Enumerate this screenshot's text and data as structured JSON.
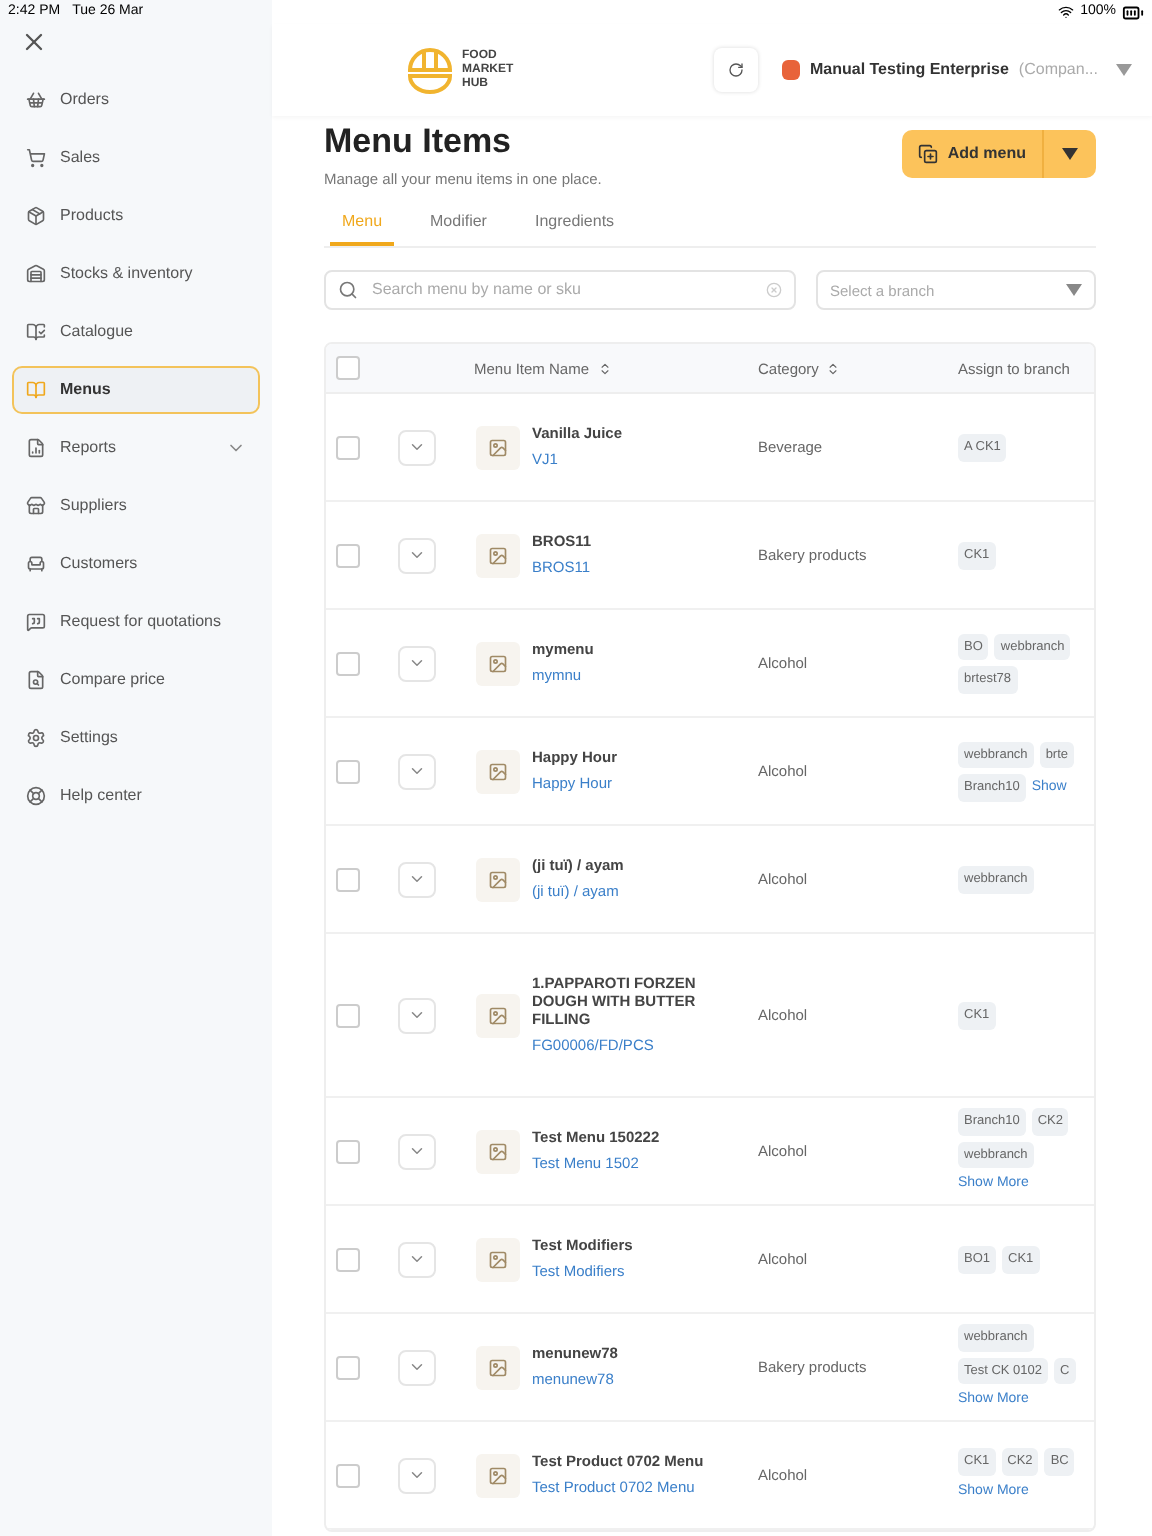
{
  "status_bar": {
    "time": "2:42 PM",
    "date": "Tue 26 Mar",
    "battery": "100%"
  },
  "sidebar": {
    "items": [
      {
        "label": "Orders",
        "selected": false
      },
      {
        "label": "Sales",
        "selected": false
      },
      {
        "label": "Products",
        "selected": false
      },
      {
        "label": "Stocks & inventory",
        "selected": false
      },
      {
        "label": "Catalogue",
        "selected": false
      },
      {
        "label": "Menus",
        "selected": true
      },
      {
        "label": "Reports",
        "selected": false,
        "expandable": true
      },
      {
        "label": "Suppliers",
        "selected": false
      },
      {
        "label": "Customers",
        "selected": false
      },
      {
        "label": "Request for quotations",
        "selected": false
      },
      {
        "label": "Compare price",
        "selected": false
      },
      {
        "label": "Settings",
        "selected": false
      },
      {
        "label": "Help center",
        "selected": false
      }
    ]
  },
  "header": {
    "logo_text": "FOOD MARKET HUB",
    "company": "Manual Testing Enterprise",
    "company_note": "(Compan..."
  },
  "page": {
    "title": "Menu Items",
    "subtitle": "Manage all your menu items in one place.",
    "add_button": "Add menu"
  },
  "tabs": [
    {
      "label": "Menu",
      "selected": true
    },
    {
      "label": "Modifier",
      "selected": false
    },
    {
      "label": "Ingredients",
      "selected": false
    }
  ],
  "search": {
    "placeholder": "Search menu by name or sku"
  },
  "branch_select": {
    "placeholder": "Select a branch"
  },
  "table": {
    "select_all_checked": false,
    "columns": [
      "Menu Item Name",
      "Category",
      "Assign to branch"
    ],
    "rows": [
      {
        "checked": false,
        "name": "Vanilla Juice",
        "sku": "VJ1",
        "category": "Beverage",
        "branch_lines": [
          [
            {
              "kind": "tag",
              "text": "A CK1"
            }
          ]
        ]
      },
      {
        "checked": false,
        "name": "BROS11",
        "sku": "BROS11",
        "category": "Bakery products",
        "branch_lines": [
          [
            {
              "kind": "tag",
              "text": "CK1"
            }
          ]
        ]
      },
      {
        "checked": false,
        "name": "mymenu",
        "sku": "mymnu",
        "category": "Alcohol",
        "branch_lines": [
          [
            {
              "kind": "tag",
              "text": "BO"
            },
            {
              "kind": "tag",
              "text": "webbranch"
            }
          ],
          [
            {
              "kind": "tag",
              "text": "brtest78"
            }
          ]
        ]
      },
      {
        "checked": false,
        "name": "Happy Hour",
        "sku": "Happy Hour",
        "category": "Alcohol",
        "branch_lines": [
          [
            {
              "kind": "tag",
              "text": "webbranch"
            },
            {
              "kind": "tag",
              "text": "brte"
            }
          ],
          [
            {
              "kind": "tag",
              "text": "Branch10"
            },
            {
              "kind": "link",
              "text": "Show"
            }
          ]
        ]
      },
      {
        "checked": false,
        "name": "(ji tuï) / ayam",
        "sku": "(ji tuï) / ayam",
        "category": "Alcohol",
        "branch_lines": [
          [
            {
              "kind": "tag",
              "text": "webbranch"
            }
          ]
        ]
      },
      {
        "checked": false,
        "name": "1.PAPPAROTI FORZEN DOUGH WITH BUTTER FILLING",
        "sku": "FG00006/FD/PCS",
        "category": "Alcohol",
        "branch_lines": [
          [
            {
              "kind": "tag",
              "text": "CK1"
            }
          ]
        ],
        "tall": true
      },
      {
        "checked": false,
        "name": "Test Menu 150222",
        "sku": "Test Menu 1502",
        "category": "Alcohol",
        "branch_lines": [
          [
            {
              "kind": "tag",
              "text": "Branch10"
            },
            {
              "kind": "tag",
              "text": "CK2"
            }
          ],
          [
            {
              "kind": "tag",
              "text": "webbranch"
            }
          ],
          [
            {
              "kind": "link",
              "text": "Show More"
            }
          ]
        ]
      },
      {
        "checked": false,
        "name": "Test Modifiers",
        "sku": "Test Modifiers",
        "category": "Alcohol",
        "branch_lines": [
          [
            {
              "kind": "tag",
              "text": "BO1"
            },
            {
              "kind": "tag",
              "text": "CK1"
            }
          ]
        ]
      },
      {
        "checked": false,
        "name": "menunew78",
        "sku": "menunew78",
        "category": "Bakery products",
        "branch_lines": [
          [
            {
              "kind": "tag",
              "text": "webbranch"
            }
          ],
          [
            {
              "kind": "tag",
              "text": "Test CK 0102"
            },
            {
              "kind": "tag",
              "text": "C"
            }
          ],
          [
            {
              "kind": "link",
              "text": "Show More"
            }
          ]
        ]
      },
      {
        "checked": false,
        "name": "Test Product 0702 Menu",
        "sku": "Test Product 0702 Menu",
        "category": "Alcohol",
        "branch_lines": [
          [
            {
              "kind": "tag",
              "text": "CK1"
            },
            {
              "kind": "tag",
              "text": "CK2"
            },
            {
              "kind": "tag",
              "text": "BC"
            }
          ],
          [
            {
              "kind": "link",
              "text": "Show More"
            }
          ]
        ]
      }
    ]
  }
}
